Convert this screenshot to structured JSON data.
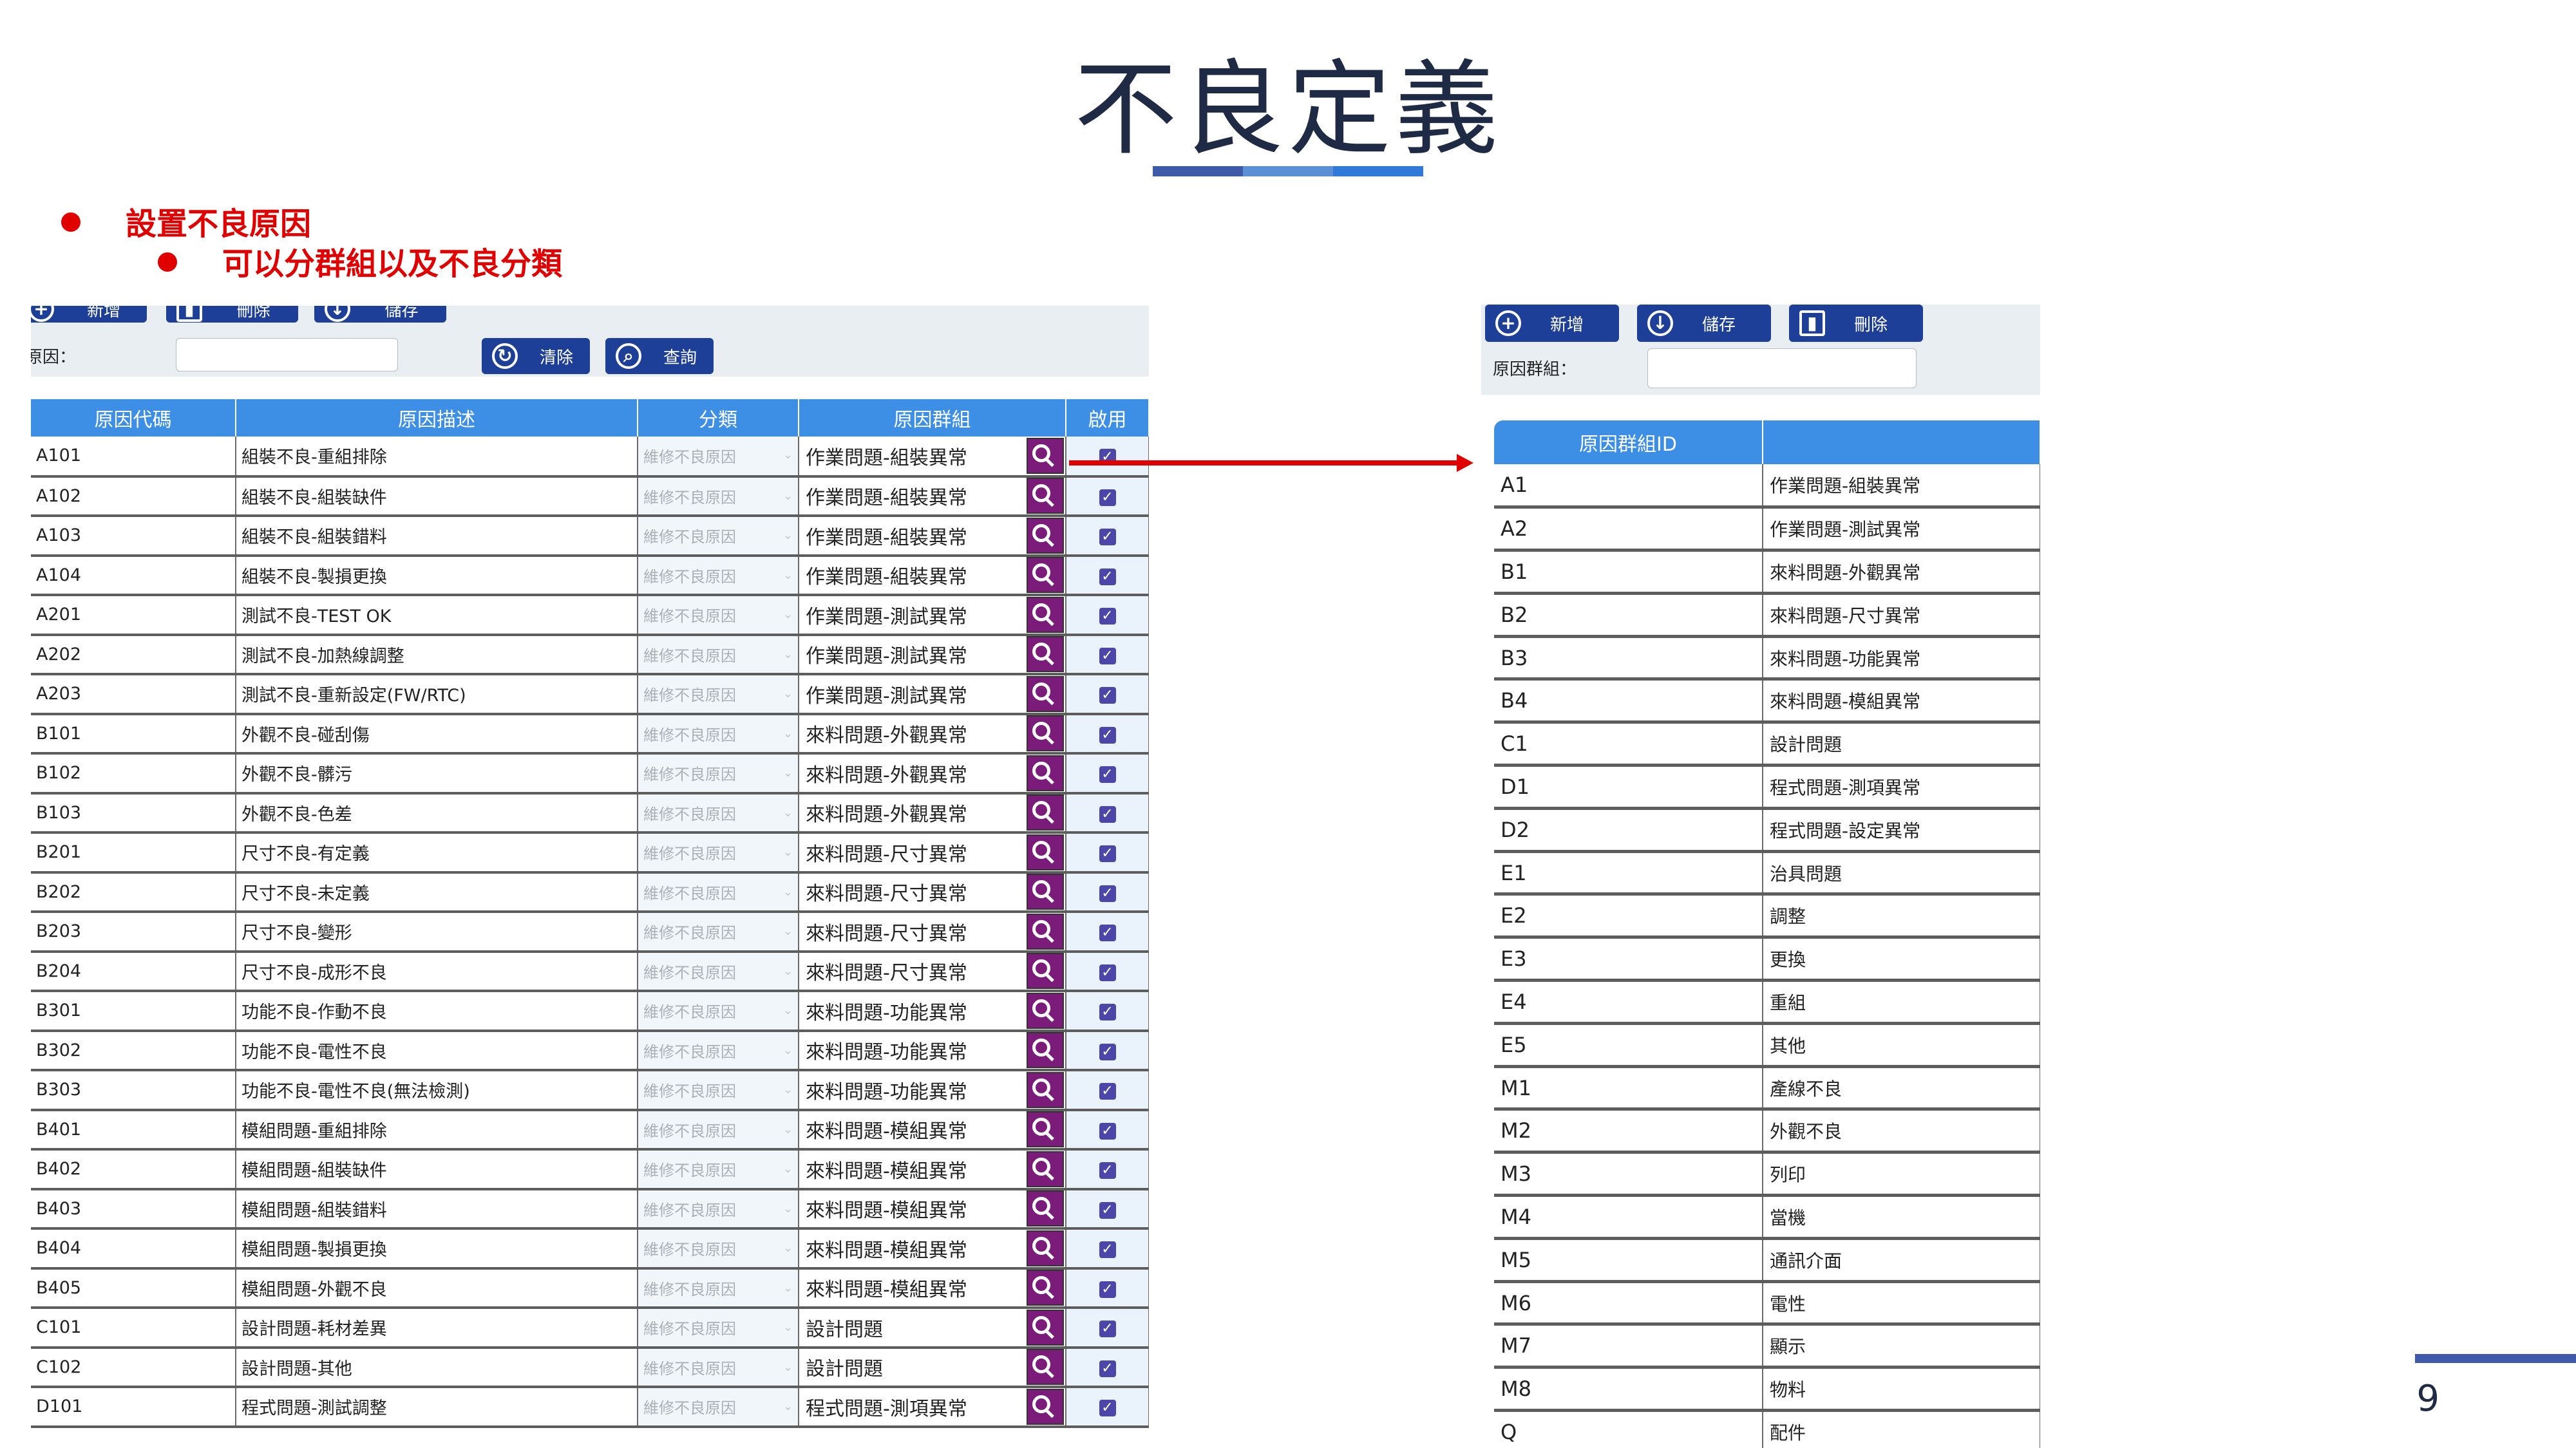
{
  "slide": {
    "title": "不良定義",
    "bullet1": "設置不良原因",
    "bullet2": "可以分群組以及不良分類",
    "page_number": "9",
    "colors": {
      "title_bar": [
        "#3f5aa8",
        "#5b8fd6",
        "#2f7ad9"
      ],
      "bullet": "#e00000"
    }
  },
  "left_panel": {
    "toolbar": {
      "new_label": "新增",
      "delete_label": "刪除",
      "save_label": "儲存",
      "clear_label": "清除",
      "query_label": "查詢",
      "field_label": "原因："
    },
    "columns": [
      "原因代碼",
      "原因描述",
      "分類",
      "原因群組",
      "啟用"
    ],
    "category_placeholder": "維修不良原因",
    "rows": [
      {
        "code": "A101",
        "desc": "組裝不良-重組排除",
        "group": "作業問題-組裝異常"
      },
      {
        "code": "A102",
        "desc": "組裝不良-組裝缺件",
        "group": "作業問題-組裝異常"
      },
      {
        "code": "A103",
        "desc": "組裝不良-組裝錯料",
        "group": "作業問題-組裝異常"
      },
      {
        "code": "A104",
        "desc": "組裝不良-製損更換",
        "group": "作業問題-組裝異常"
      },
      {
        "code": "A201",
        "desc": "測試不良-TEST OK",
        "group": "作業問題-測試異常"
      },
      {
        "code": "A202",
        "desc": "測試不良-加熱線調整",
        "group": "作業問題-測試異常"
      },
      {
        "code": "A203",
        "desc": "測試不良-重新設定(FW/RTC)",
        "group": "作業問題-測試異常"
      },
      {
        "code": "B101",
        "desc": "外觀不良-碰刮傷",
        "group": "來料問題-外觀異常"
      },
      {
        "code": "B102",
        "desc": "外觀不良-髒污",
        "group": "來料問題-外觀異常"
      },
      {
        "code": "B103",
        "desc": "外觀不良-色差",
        "group": "來料問題-外觀異常"
      },
      {
        "code": "B201",
        "desc": "尺寸不良-有定義",
        "group": "來料問題-尺寸異常"
      },
      {
        "code": "B202",
        "desc": "尺寸不良-未定義",
        "group": "來料問題-尺寸異常"
      },
      {
        "code": "B203",
        "desc": "尺寸不良-變形",
        "group": "來料問題-尺寸異常"
      },
      {
        "code": "B204",
        "desc": "尺寸不良-成形不良",
        "group": "來料問題-尺寸異常"
      },
      {
        "code": "B301",
        "desc": "功能不良-作動不良",
        "group": "來料問題-功能異常"
      },
      {
        "code": "B302",
        "desc": "功能不良-電性不良",
        "group": "來料問題-功能異常"
      },
      {
        "code": "B303",
        "desc": "功能不良-電性不良(無法檢測)",
        "group": "來料問題-功能異常"
      },
      {
        "code": "B401",
        "desc": "模組問題-重組排除",
        "group": "來料問題-模組異常"
      },
      {
        "code": "B402",
        "desc": "模組問題-組裝缺件",
        "group": "來料問題-模組異常"
      },
      {
        "code": "B403",
        "desc": "模組問題-組裝錯料",
        "group": "來料問題-模組異常"
      },
      {
        "code": "B404",
        "desc": "模組問題-製損更換",
        "group": "來料問題-模組異常"
      },
      {
        "code": "B405",
        "desc": "模組問題-外觀不良",
        "group": "來料問題-模組異常"
      },
      {
        "code": "C101",
        "desc": "設計問題-耗材差異",
        "group": "設計問題"
      },
      {
        "code": "C102",
        "desc": "設計問題-其他",
        "group": "設計問題"
      },
      {
        "code": "D101",
        "desc": "程式問題-測試調整",
        "group": "程式問題-測項異常"
      }
    ]
  },
  "right_panel": {
    "toolbar": {
      "new_label": "新增",
      "save_label": "儲存",
      "delete_label": "刪除",
      "field_label": "原因群組："
    },
    "columns": [
      "原因群組ID",
      ""
    ],
    "rows": [
      {
        "id": "A1",
        "desc": "作業問題-組裝異常"
      },
      {
        "id": "A2",
        "desc": "作業問題-測試異常"
      },
      {
        "id": "B1",
        "desc": "來料問題-外觀異常"
      },
      {
        "id": "B2",
        "desc": "來料問題-尺寸異常"
      },
      {
        "id": "B3",
        "desc": "來料問題-功能異常"
      },
      {
        "id": "B4",
        "desc": "來料問題-模組異常"
      },
      {
        "id": "C1",
        "desc": "設計問題"
      },
      {
        "id": "D1",
        "desc": "程式問題-測項異常"
      },
      {
        "id": "D2",
        "desc": "程式問題-設定異常"
      },
      {
        "id": "E1",
        "desc": "治具問題"
      },
      {
        "id": "E2",
        "desc": "調整"
      },
      {
        "id": "E3",
        "desc": "更換"
      },
      {
        "id": "E4",
        "desc": "重組"
      },
      {
        "id": "E5",
        "desc": "其他"
      },
      {
        "id": "M1",
        "desc": "產線不良"
      },
      {
        "id": "M2",
        "desc": "外觀不良"
      },
      {
        "id": "M3",
        "desc": "列印"
      },
      {
        "id": "M4",
        "desc": "當機"
      },
      {
        "id": "M5",
        "desc": "通訊介面"
      },
      {
        "id": "M6",
        "desc": "電性"
      },
      {
        "id": "M7",
        "desc": "顯示"
      },
      {
        "id": "M8",
        "desc": "物料"
      },
      {
        "id": "Q",
        "desc": "配件"
      }
    ]
  }
}
